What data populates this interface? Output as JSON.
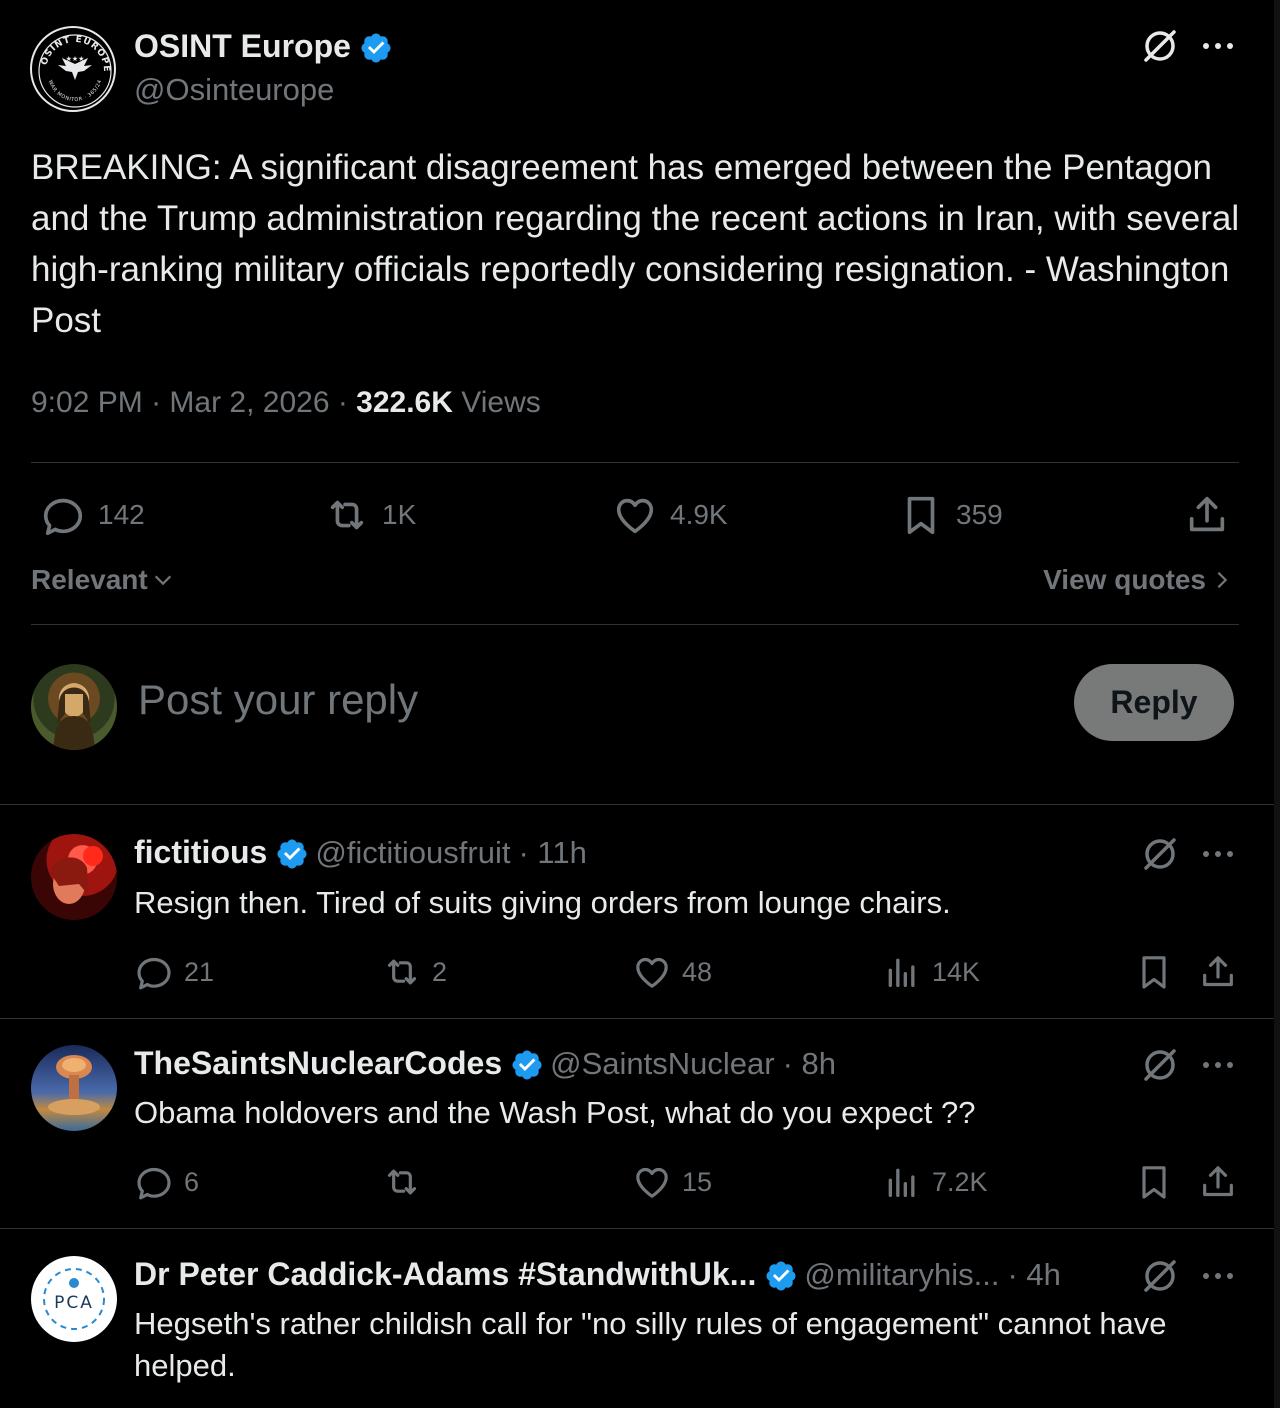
{
  "post": {
    "author_name": "OSINT Europe",
    "author_handle": "@Osinteurope",
    "avatar_text_top": "OSINT EUROPE",
    "avatar_text_bottom": "WAR MONITOR · 365/24",
    "text": "BREAKING: A significant disagreement has emerged between the Pentagon and the Trump administration regarding the recent actions in Iran, with several high-ranking military officials reportedly considering resignation. - Washington Post",
    "time": "9:02 PM",
    "date": "Mar 2, 2026",
    "views_count": "322.6K",
    "views_label": "Views",
    "replies": "142",
    "reposts": "1K",
    "likes": "4.9K",
    "bookmarks": "359"
  },
  "sort_label": "Relevant",
  "view_quotes_label": "View quotes",
  "composer": {
    "placeholder": "Post your reply",
    "button_label": "Reply"
  },
  "replies": [
    {
      "name": "fictitious",
      "handle": "@fictitiousfruit",
      "time": "· 11h",
      "text": "Resign then. Tired of suits giving orders from lounge chairs.",
      "replies": "21",
      "reposts": "2",
      "likes": "48",
      "views": "14K"
    },
    {
      "name": "TheSaintsNuclearCodes",
      "handle": "@SaintsNuclear",
      "time": "· 8h",
      "text": "Obama holdovers and the Wash Post, what do you expect ??",
      "replies": "6",
      "reposts": "",
      "likes": "15",
      "views": "7.2K"
    },
    {
      "name": "Dr Peter Caddick-Adams #StandwithUk...",
      "handle": "@militaryhis...",
      "time": "· 4h",
      "text": "Hegseth's rather childish call for \"no silly rules of engagement\" cannot have helped.",
      "avatar_text": "PCA"
    }
  ],
  "colors": {
    "background": "#000000",
    "text": "#e7e9ea",
    "muted": "#71767b",
    "verified": "#1d9bf0",
    "divider": "#2f3336",
    "reply_button": "#787a7a"
  },
  "icons": [
    "grok-icon",
    "more-icon",
    "reply-icon",
    "repost-icon",
    "like-icon",
    "bookmark-icon",
    "share-icon",
    "views-icon",
    "verified-badge-icon",
    "chevron-down-icon",
    "chevron-right-icon"
  ]
}
